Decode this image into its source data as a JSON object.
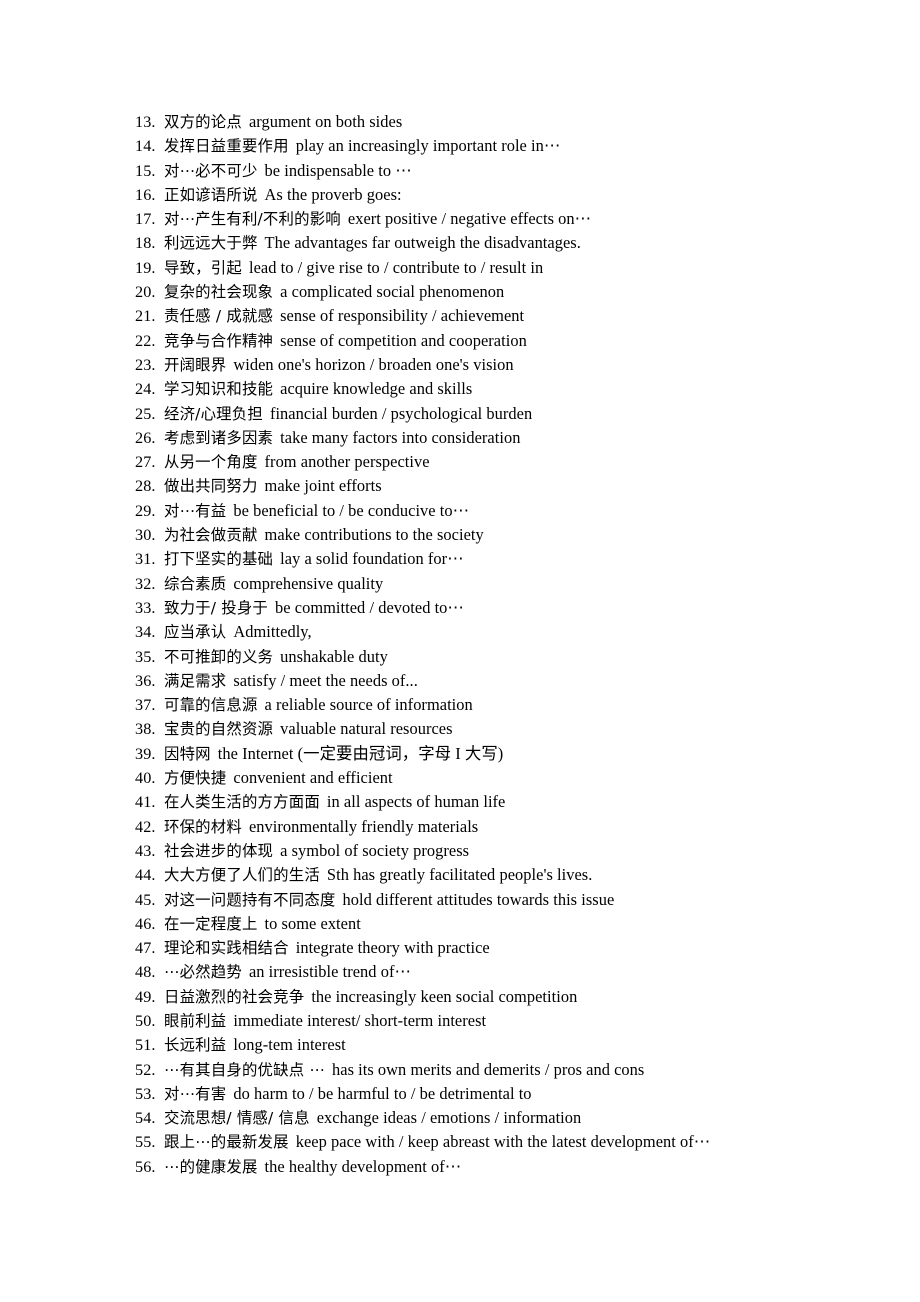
{
  "document": {
    "background_color": "#ffffff",
    "text_color": "#000000",
    "items": [
      {
        "number": "13.",
        "cn": "双方的论点",
        "en": "argument on both sides"
      },
      {
        "number": "14.",
        "cn": "发挥日益重要作用",
        "en": "play an increasingly important role in⋯"
      },
      {
        "number": "15.",
        "cn": "对⋯必不可少",
        "en": "be indispensable to  ⋯"
      },
      {
        "number": "16.",
        "cn": "正如谚语所说",
        "en": "As the proverb goes:"
      },
      {
        "number": "17.",
        "cn": "对⋯产生有利/不利的影响",
        "en": "exert positive / negative effects on⋯"
      },
      {
        "number": "18.",
        "cn": "利远远大于弊",
        "en": "The advantages far outweigh the disadvantages."
      },
      {
        "number": "19.",
        "cn": "导致，引起",
        "en": "lead to / give rise to / contribute to / result in"
      },
      {
        "number": "20.",
        "cn": "复杂的社会现象",
        "en": "a complicated social phenomenon"
      },
      {
        "number": "21.",
        "cn": "责任感 / 成就感",
        "en": "sense of responsibility / achievement"
      },
      {
        "number": "22.",
        "cn": "竞争与合作精神",
        "en": "sense of competition and cooperation"
      },
      {
        "number": "23.",
        "cn": "开阔眼界",
        "en": "widen one's horizon / broaden one's vision"
      },
      {
        "number": "24.",
        "cn": "学习知识和技能",
        "en": "acquire knowledge and skills"
      },
      {
        "number": "25.",
        "cn": "经济/心理负担",
        "en": "financial burden / psychological burden"
      },
      {
        "number": "26.",
        "cn": "考虑到诸多因素",
        "en": "take many factors into consideration"
      },
      {
        "number": "27.",
        "cn": "从另一个角度",
        "en": "from another perspective"
      },
      {
        "number": "28.",
        "cn": "做出共同努力",
        "en": "make joint efforts"
      },
      {
        "number": "29.",
        "cn": "对⋯有益",
        "en": "be beneficial to / be conducive to⋯"
      },
      {
        "number": "30.",
        "cn": "为社会做贡献",
        "en": "make contributions to the society"
      },
      {
        "number": "31.",
        "cn": "打下坚实的基础",
        "en": "lay a solid foundation for⋯"
      },
      {
        "number": "32.",
        "cn": "综合素质",
        "en": "comprehensive quality"
      },
      {
        "number": "33.",
        "cn": "致力于/ 投身于",
        "en": "be committed / devoted to⋯"
      },
      {
        "number": "34.",
        "cn": "应当承认",
        "en": "Admittedly,"
      },
      {
        "number": "35.",
        "cn": "不可推卸的义务",
        "en": "unshakable duty"
      },
      {
        "number": "36.",
        "cn": "满足需求",
        "en": "satisfy / meet the needs of..."
      },
      {
        "number": "37.",
        "cn": "可靠的信息源",
        "en": "a reliable source of information"
      },
      {
        "number": "38.",
        "cn": "宝贵的自然资源",
        "en": "valuable natural resources"
      },
      {
        "number": "39.",
        "cn": "因特网",
        "en": "the Internet (一定要由冠词，字母 I 大写)"
      },
      {
        "number": "40.",
        "cn": "方便快捷",
        "en": "convenient and efficient"
      },
      {
        "number": "41.",
        "cn": "在人类生活的方方面面",
        "en": "in all aspects of human life"
      },
      {
        "number": "42.",
        "cn": "环保的材料",
        "en": "environmentally friendly materials"
      },
      {
        "number": "43.",
        "cn": "社会进步的体现",
        "en": "a symbol of society progress"
      },
      {
        "number": "44.",
        "cn": "大大方便了人们的生活",
        "en": "Sth has greatly facilitated people's lives."
      },
      {
        "number": "45.",
        "cn": "对这一问题持有不同态度",
        "en": "hold different attitudes towards this issue"
      },
      {
        "number": "46.",
        "cn": "在一定程度上",
        "en": "to some extent"
      },
      {
        "number": "47.",
        "cn": "理论和实践相结合",
        "en": "integrate theory with practice"
      },
      {
        "number": "48.",
        "cn": "⋯必然趋势",
        "en": "an irresistible trend of⋯"
      },
      {
        "number": "49.",
        "cn": "日益激烈的社会竞争",
        "en": "the increasingly keen social competition"
      },
      {
        "number": "50.",
        "cn": "眼前利益",
        "en": "immediate interest/ short-term interest"
      },
      {
        "number": "51.",
        "cn": "长远利益",
        "en": "long-tem interest"
      },
      {
        "number": "52.",
        "cn": "⋯有其自身的优缺点 ⋯",
        "en": "has its own merits and demerits / pros and cons"
      },
      {
        "number": "53.",
        "cn": "对⋯有害",
        "en": "do harm to / be harmful to / be detrimental to"
      },
      {
        "number": "54.",
        "cn": "交流思想/ 情感/ 信息",
        "en": "exchange ideas / emotions / information"
      },
      {
        "number": "55.",
        "cn": "跟上⋯的最新发展",
        "en": "keep pace with / keep abreast with the latest development of⋯"
      },
      {
        "number": "56.",
        "cn": "⋯的健康发展",
        "en": "the healthy development of⋯"
      }
    ]
  }
}
